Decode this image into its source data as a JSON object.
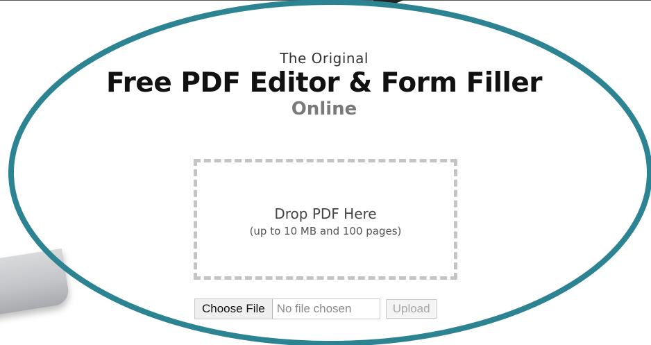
{
  "hero": {
    "eyebrow": "The Original",
    "headline": "Free PDF Editor & Form Filler",
    "subheadline": "Online"
  },
  "upload": {
    "drop_zone_title": "Drop PDF Here",
    "drop_zone_hint": "(up to 10 MB and 100 pages)",
    "choose_file_label": "Choose File",
    "file_status": "No file chosen",
    "upload_label": "Upload"
  },
  "colors": {
    "highlight_ellipse": "#2c8391",
    "headline": "#111111",
    "subheadline": "#7a7a7a",
    "drop_zone_border": "#c4c4c4"
  },
  "icons": {
    "highlight": "ellipse-annotation",
    "decor": "laptop-image"
  }
}
